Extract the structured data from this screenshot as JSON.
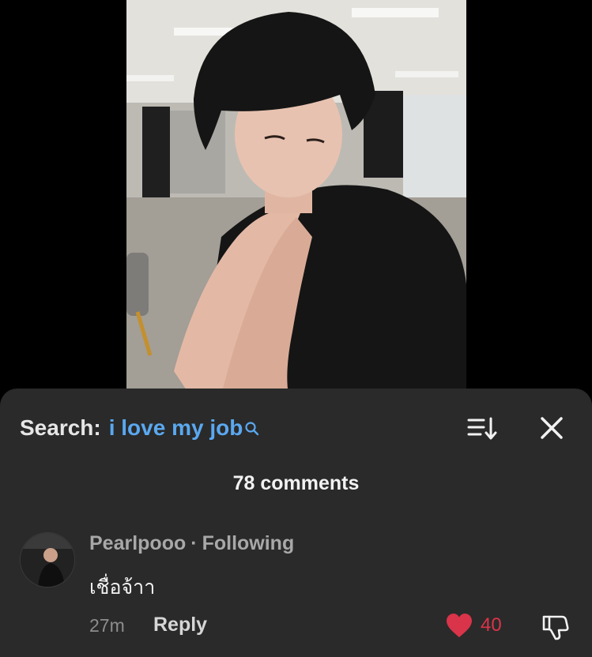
{
  "media": {
    "description_icon": "portrait-photo"
  },
  "search": {
    "prefix": "Search:",
    "query": "i love my job",
    "query_icon": "search-icon",
    "query_color": "#5aa8f0"
  },
  "controls": {
    "sort_icon": "sort-icon",
    "close_icon": "close-icon"
  },
  "comments": {
    "count_label": "78 comments",
    "items": [
      {
        "username": "Pearlpooo",
        "separator": "·",
        "relation": "Following",
        "text": "เชื่อจ้าา",
        "time": "27m",
        "reply_label": "Reply",
        "likes": "40",
        "liked": true,
        "like_color": "#d9344a"
      }
    ]
  }
}
